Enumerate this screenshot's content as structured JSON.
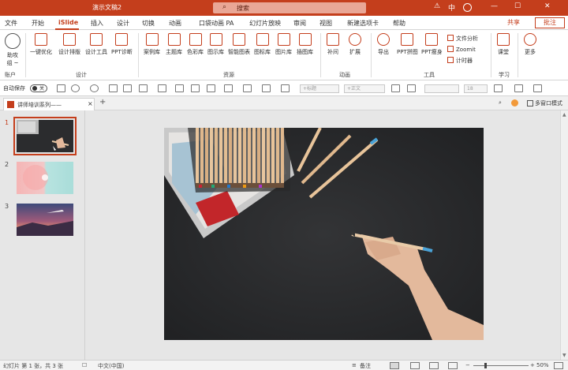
{
  "window": {
    "title": "演示文稿2",
    "search_placeholder": "搜索",
    "user_initial": "中",
    "icon_info": "ⓘ",
    "icon_min": "—",
    "icon_max": "☐",
    "icon_close": "✕",
    "icon_warning": "⚠"
  },
  "menu": {
    "items": [
      "文件",
      "开始",
      "iSlide",
      "插入",
      "设计",
      "切换",
      "动画",
      "口袋动画 PA",
      "幻灯片放映",
      "审阅",
      "视图",
      "新建选项卡",
      "帮助"
    ],
    "active_index": 2,
    "share": "共享",
    "comment": "批注"
  },
  "ribbon": {
    "account": {
      "label1": "助攻",
      "label2": "组 ~",
      "group": "账户"
    },
    "design_group": {
      "label": "设计",
      "buttons": [
        "一键优化",
        "设计排版",
        "设计工具",
        "PPT诊断"
      ]
    },
    "resource_group": {
      "label": "资源",
      "buttons": [
        "案例库",
        "主题库",
        "色彩库",
        "图示库",
        "智能图表",
        "图标库",
        "图片库",
        "插图库"
      ]
    },
    "animation_group": {
      "label": "动画",
      "buttons": [
        "补间",
        "扩展"
      ]
    },
    "tools_group": {
      "label": "工具",
      "buttons": [
        "导出",
        "PPT拼图",
        "PPT瘦身"
      ],
      "small": [
        "文件分析",
        "Zoomit",
        "计时器"
      ]
    },
    "learn_group": {
      "label": "学习",
      "buttons": [
        "课堂"
      ]
    },
    "more": "更多"
  },
  "qat": {
    "autosave_label": "自动保存",
    "toggle_state": "关",
    "font_name": "+标题",
    "font_name_east": "+正文",
    "font_size": "18"
  },
  "tabs": {
    "doc_tab": "讲师培训系列——",
    "close": "×",
    "add": "+",
    "right_mode": "多窗口模式"
  },
  "slides": [
    {
      "number": "1",
      "selected": true
    },
    {
      "number": "2",
      "selected": false
    },
    {
      "number": "3",
      "selected": false
    }
  ],
  "status": {
    "slide_info": "幻灯片 第 1 张，共 3 张",
    "language": "中文(中国)",
    "notes": "备注",
    "zoom": "50%",
    "zoom_minus": "−",
    "zoom_plus": "+"
  }
}
